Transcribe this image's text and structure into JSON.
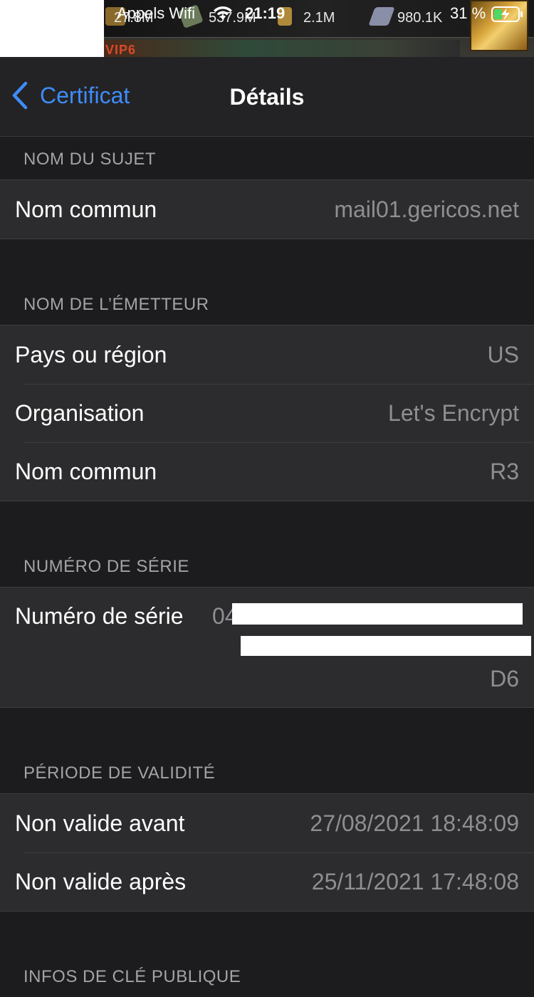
{
  "status_bar": {
    "carrier": "Appels Wifi",
    "time": "21:19",
    "battery": "31 %",
    "game_resources": [
      {
        "icon": "coin-stack-icon",
        "value": "27.8M"
      },
      {
        "icon": "cash-icon",
        "value": "537.9M"
      },
      {
        "icon": "ammo-icon",
        "value": "2.1M"
      },
      {
        "icon": "steel-icon",
        "value": "980.1K"
      }
    ],
    "game_vip": "VIP6"
  },
  "nav": {
    "back_label": "Certificat",
    "title": "Détails"
  },
  "sections": {
    "subject": {
      "header": "NOM DU SUJET",
      "rows": [
        {
          "label": "Nom commun",
          "value": "mail01.gericos.net"
        }
      ]
    },
    "issuer": {
      "header": "NOM DE L’ÉMETTEUR",
      "rows": [
        {
          "label": "Pays ou région",
          "value": "US"
        },
        {
          "label": "Organisation",
          "value": "Let's Encrypt"
        },
        {
          "label": "Nom commun",
          "value": "R3"
        }
      ]
    },
    "serial": {
      "header": "NUMÉRO DE SÉRIE",
      "label": "Numéro de série",
      "value_start": "04",
      "value_end": "D6"
    },
    "validity": {
      "header": "PÉRIODE DE VALIDITÉ",
      "rows": [
        {
          "label": "Non valide avant",
          "value": "27/08/2021 18:48:09"
        },
        {
          "label": "Non valide après",
          "value": "25/11/2021 17:48:08"
        }
      ]
    },
    "public_key": {
      "header": "INFOS DE CLÉ PUBLIQUE"
    }
  },
  "colors": {
    "accent": "#3e8cf7",
    "background": "#1c1c1e",
    "cell": "#2c2c2e",
    "secondary_text": "#8e8e93"
  }
}
